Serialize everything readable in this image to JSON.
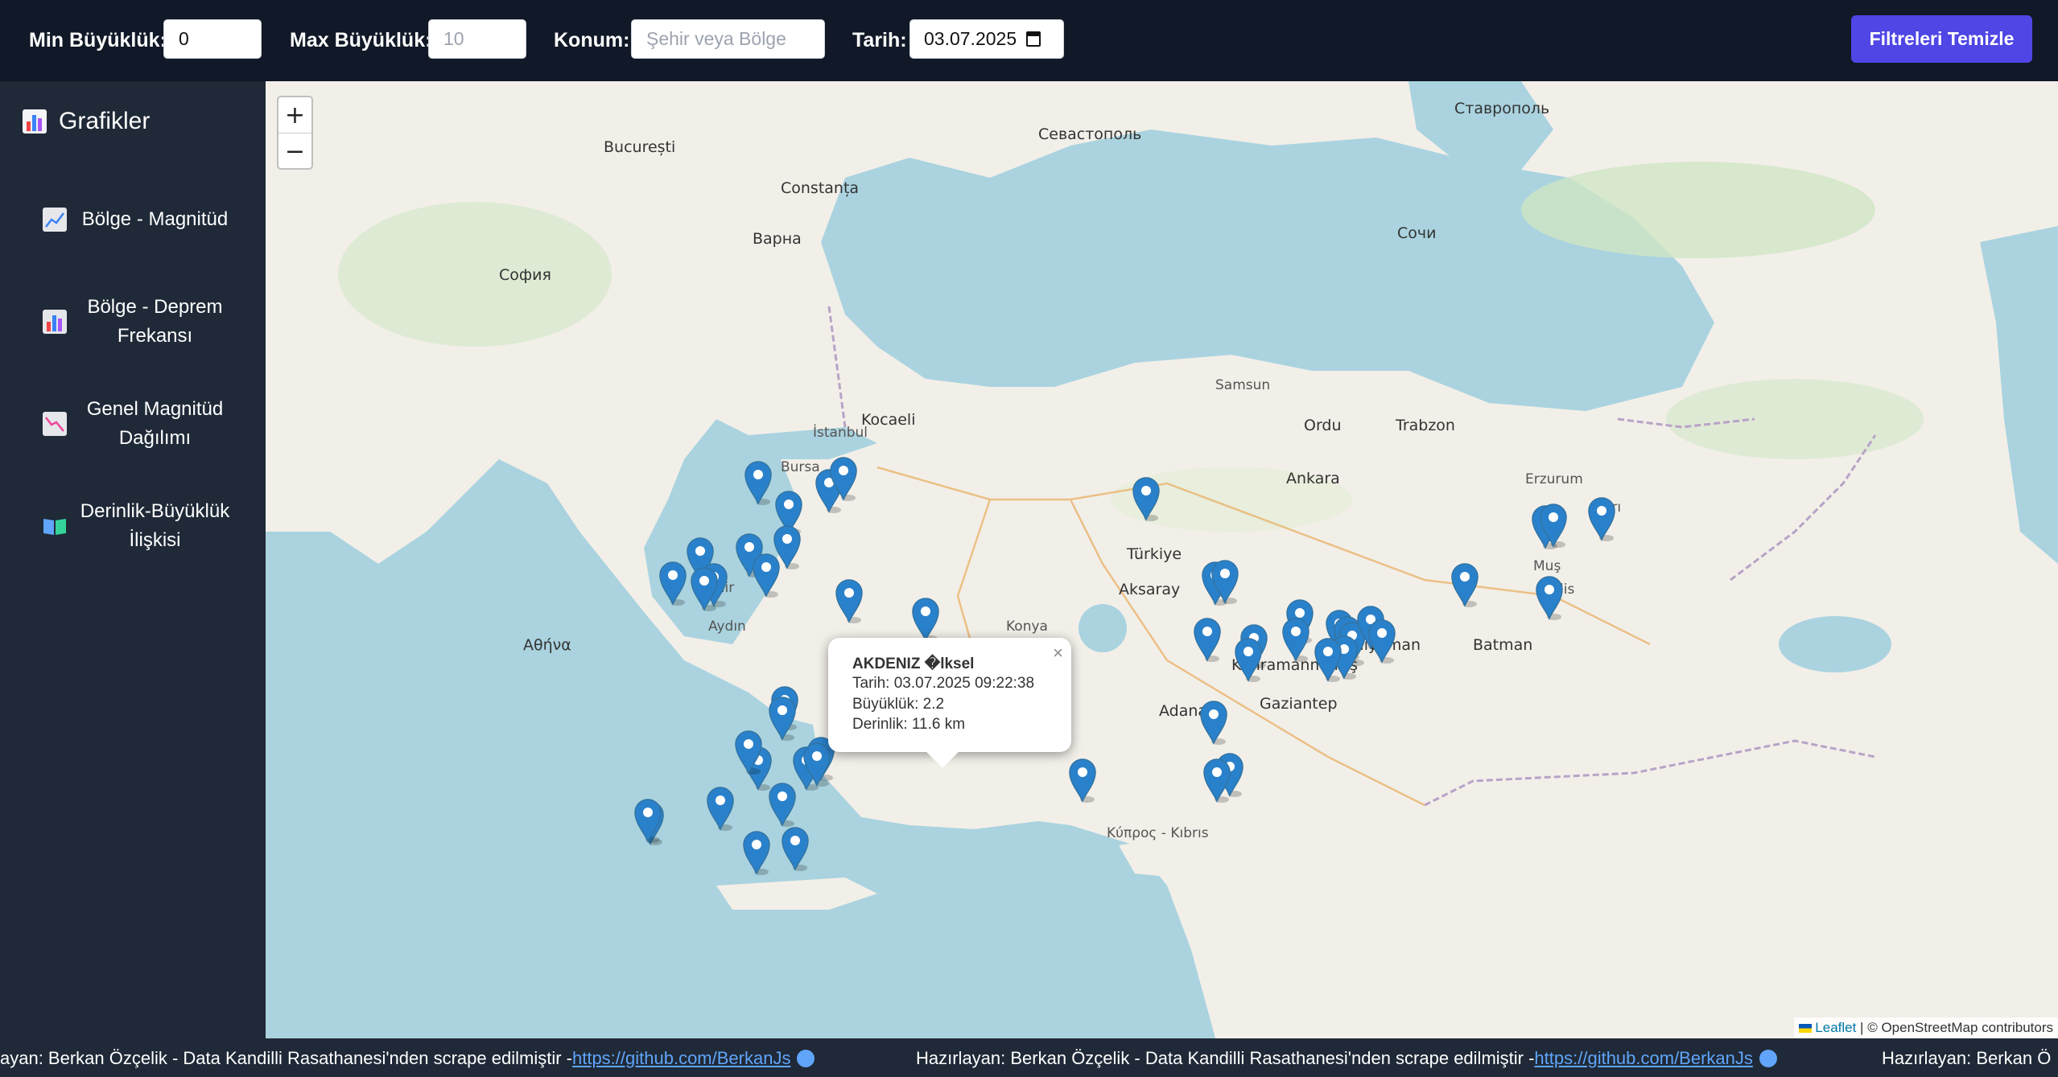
{
  "filters": {
    "min_label": "Min Büyüklük:",
    "min_value": "0",
    "max_label": "Max Büyüklük:",
    "max_placeholder": "10",
    "location_label": "Konum:",
    "location_placeholder": "Şehir veya Bölge",
    "date_label": "Tarih:",
    "date_value": "03.07.2025",
    "clear_button": "Filtreleri Temizle"
  },
  "sidebar": {
    "title": "Grafikler",
    "items": [
      {
        "label": "Bölge - Magnitüd",
        "icon": "line-chart-icon"
      },
      {
        "label": "Bölge - Deprem Frekansı",
        "icon": "bar-chart-icon"
      },
      {
        "label": "Genel Magnitüd Dağılımı",
        "icon": "trend-down-chart-icon"
      },
      {
        "label": "Derinlik-Büyüklük İlişkisi",
        "icon": "open-book-icon"
      }
    ]
  },
  "map": {
    "zoom_in": "+",
    "zoom_out": "−",
    "popup": {
      "title": "AKDENIZ �lksel",
      "date_line": "Tarih: 03.07.2025 09:22:38",
      "magnitude_line": "Büyüklük: 2.2",
      "depth_line": "Derinlik: 11.6 km",
      "close": "×"
    },
    "attribution": {
      "leaflet": "Leaflet",
      "rest": " | © OpenStreetMap contributors"
    },
    "labels": {
      "black_sea_city1": "Севастополь",
      "ankara": "Ankara",
      "istanbul": "İstanbul",
      "bursa": "Bursa",
      "kocaeli": "Kocaeli",
      "izmir": "İzmir",
      "aydin": "Aydın",
      "konya": "Konya",
      "aksaray": "Aksaray",
      "adana": "Adana",
      "gaziantep": "Gaziantep",
      "kahramanmaras": "Kahramanmaraş",
      "adiyaman": "Adıyaman",
      "batman": "Batman",
      "trabzon": "Trabzon",
      "ordu": "Ordu",
      "samsun": "Samsun",
      "sochi": "Сочи",
      "stavropol": "Ставрополь",
      "athens": "Αθήνα",
      "sofia": "София",
      "bucuresti": "București",
      "constanta": "Constanța",
      "varna": "Варна",
      "erzurum": "Erzurum",
      "agri": "Ağrı",
      "mus": "Muş",
      "bitlis": "Bitlis",
      "kibris": "Κύπρος - Kıbrıs",
      "turkiye": "Türkiye"
    }
  },
  "footer": {
    "text": "Hazırlayan: Berkan Özçelik - Data Kandilli Rasathanesi'nden scrape edilmiştir -",
    "text_cut": "ayan: Berkan Özçelik - Data Kandilli Rasathanesi'nden scrape edilmiştir -",
    "text_tail": "Hazırlayan: Berkan Ö",
    "link": "https://github.com/BerkanJs"
  }
}
